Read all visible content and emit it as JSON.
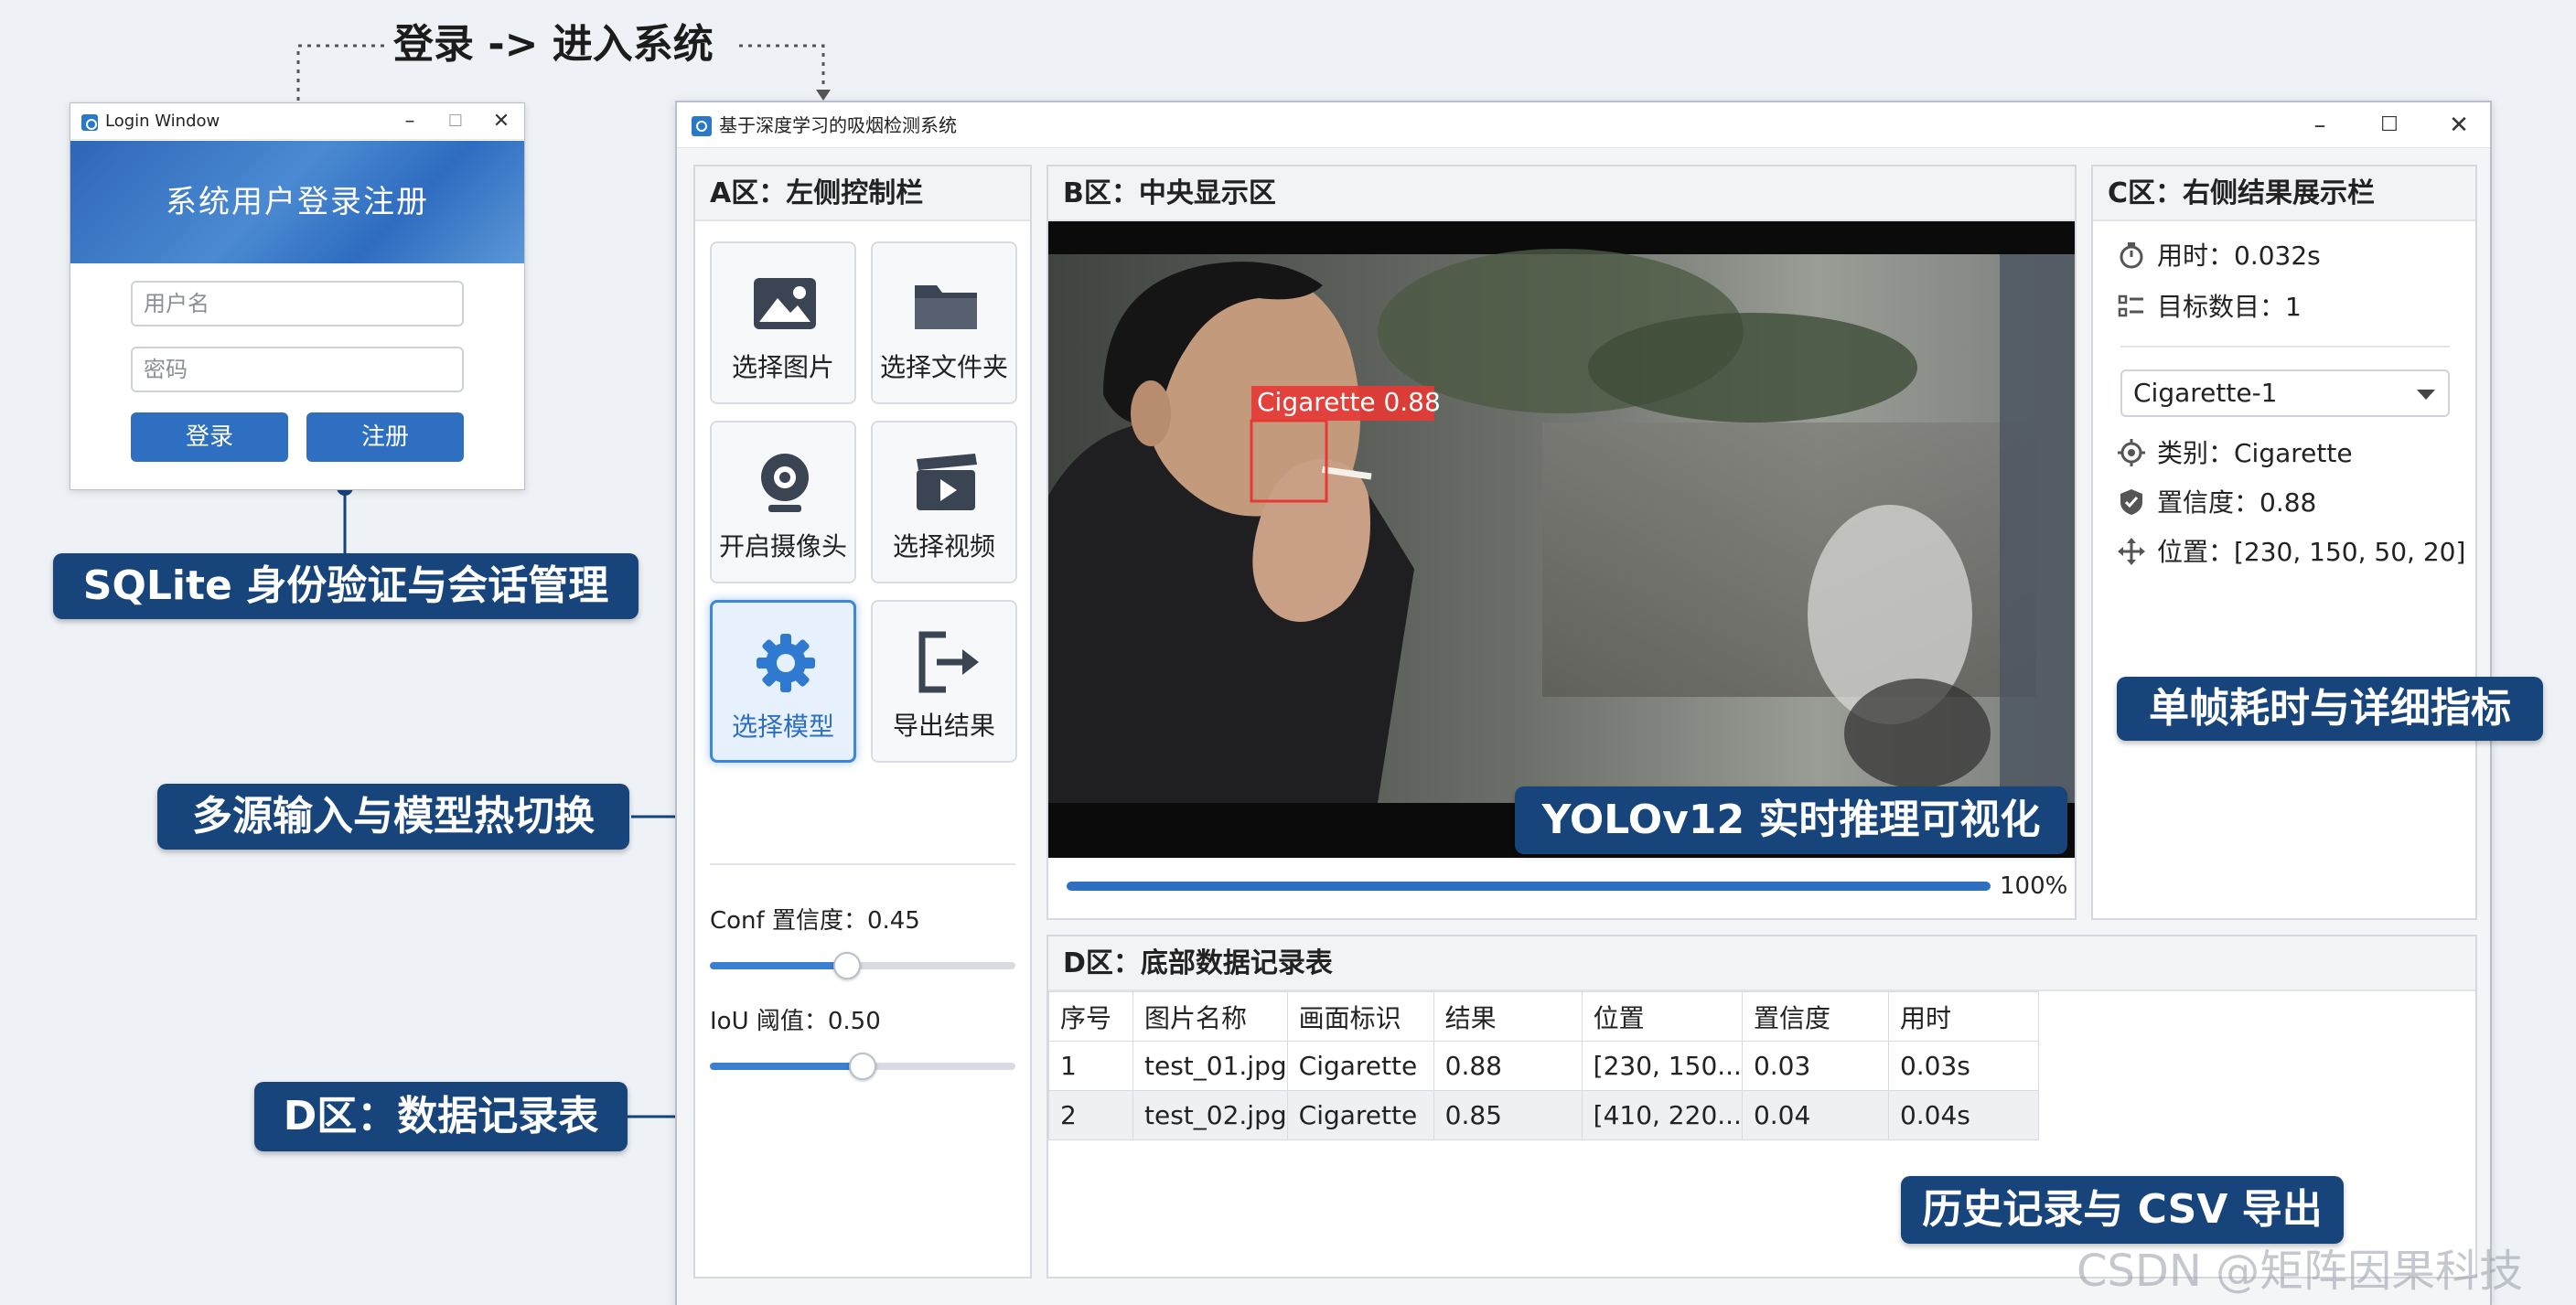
{
  "flow_caption": "登录 -> 进入系统",
  "login_window": {
    "title": "Login Window",
    "banner": "系统用户登录注册",
    "username_placeholder": "用户名",
    "password_placeholder": "密码",
    "login_button": "登录",
    "register_button": "注册"
  },
  "callouts": {
    "auth": "SQLite 身份验证与会话管理",
    "input_model": "多源输入与模型热切换",
    "table": "D区：数据记录表",
    "inference": "YOLOv12 实时推理可视化",
    "metrics": "单帧耗时与详细指标",
    "history": "历史记录与 CSV 导出"
  },
  "main_window": {
    "title": "基于深度学习的吸烟检测系统",
    "controls": {
      "minimize": "–",
      "maximize": "☐",
      "close": "✕"
    }
  },
  "panel_a": {
    "header": "A区：左侧控制栏",
    "buttons": [
      {
        "label": "选择图片",
        "icon": "image-icon"
      },
      {
        "label": "选择文件夹",
        "icon": "folder-icon"
      },
      {
        "label": "开启摄像头",
        "icon": "webcam-icon"
      },
      {
        "label": "选择视频",
        "icon": "video-icon"
      },
      {
        "label": "选择模型",
        "icon": "gear-icon"
      },
      {
        "label": "导出结果",
        "icon": "export-icon"
      }
    ],
    "conf_label": "Conf 置信度：0.45",
    "conf_value": 0.45,
    "iou_label": "IoU 阈值：0.50",
    "iou_value": 0.5
  },
  "panel_b": {
    "header": "B区：中央显示区",
    "detection_label": "Cigarette 0.88",
    "progress": 1.0,
    "progress_text": "100%"
  },
  "panel_c": {
    "header": "C区：右侧结果展示栏",
    "time": "用时：0.032s",
    "count": "目标数目：1",
    "selected_target": "Cigarette-1",
    "category": "类别：Cigarette",
    "confidence": "置信度：0.88",
    "position": "位置：[230, 150, 50, 20]"
  },
  "panel_d": {
    "header": "D区：底部数据记录表",
    "columns": [
      "序号",
      "图片名称",
      "画面标识",
      "结果",
      "位置",
      "置信度",
      "用时"
    ],
    "rows": [
      [
        "1",
        "test_01.jpg",
        "Cigarette",
        "0.88",
        "[230, 150...",
        "0.03",
        "0.03s"
      ],
      [
        "2",
        "test_02.jpg",
        "Cigarette",
        "0.85",
        "[410, 220...",
        "0.04",
        "0.04s"
      ]
    ]
  },
  "colors": {
    "accent": "#2f6fc2",
    "callout_bg": "#17447a",
    "detection_box": "#e53935"
  },
  "watermark": "CSDN @矩阵因果科技"
}
